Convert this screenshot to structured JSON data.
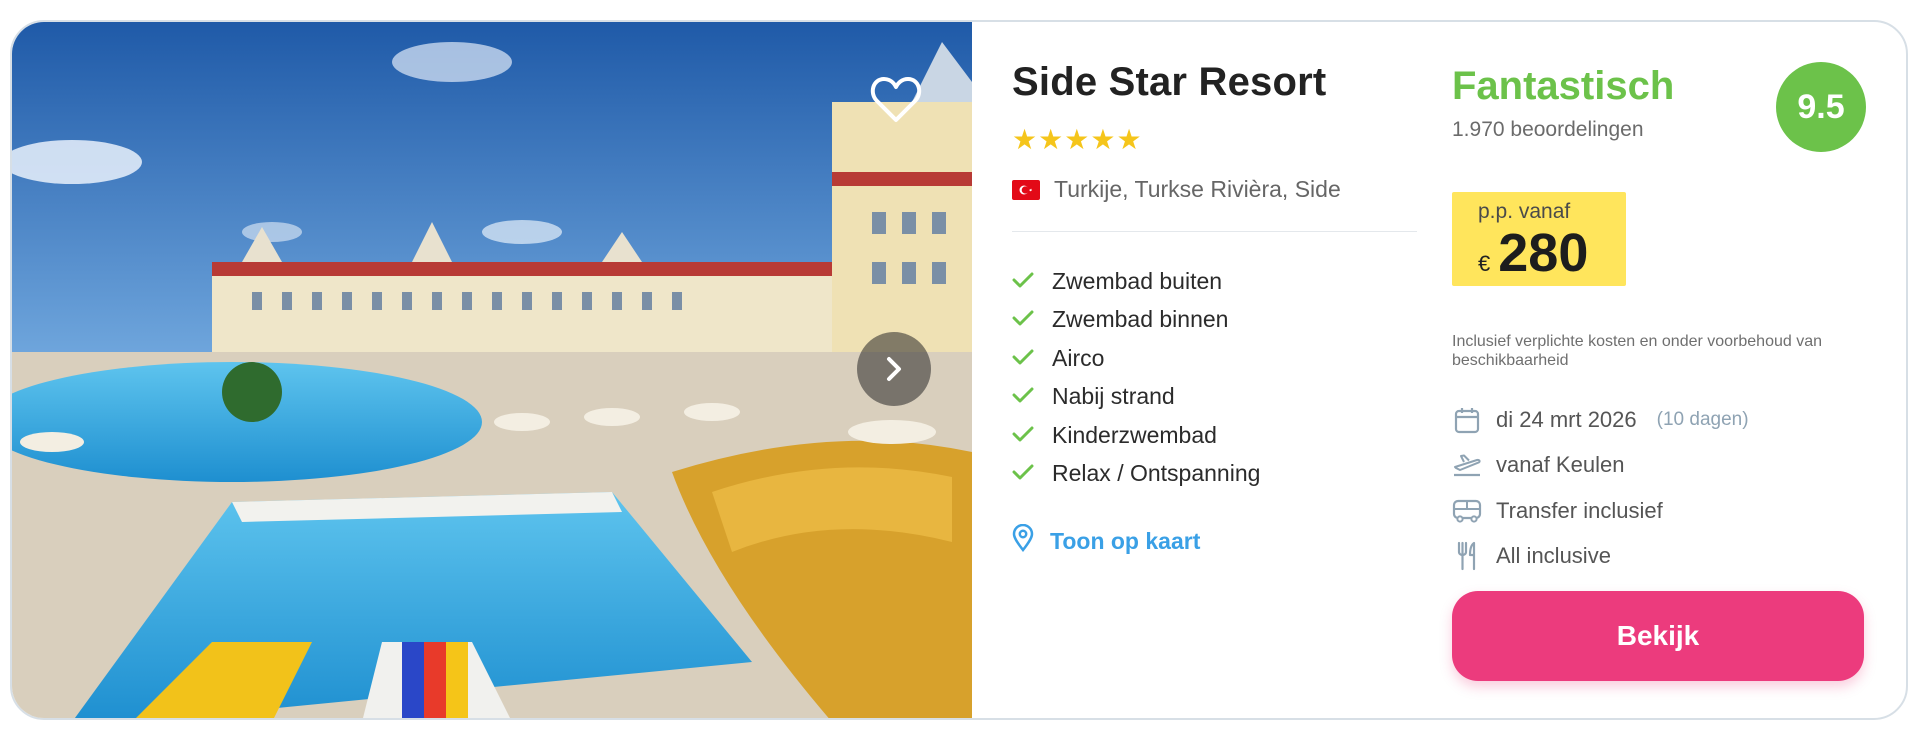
{
  "hotel": {
    "name": "Side Star Resort",
    "stars": 5,
    "star_glyph": "★",
    "location": "Turkije, Turkse Rivièra, Side",
    "flag_icon": "turkey-flag-icon",
    "features": [
      "Zwembad buiten",
      "Zwembad binnen",
      "Airco",
      "Nabij strand",
      "Kinderzwembad",
      "Relax / Ontspanning"
    ],
    "map_link": "Toon op kaart"
  },
  "rating": {
    "label": "Fantastisch",
    "reviews": "1.970 beoordelingen",
    "score": "9.5"
  },
  "price": {
    "from_label": "p.p. vanaf",
    "currency": "€",
    "amount": "280",
    "disclaimer": "Inclusief verplichte kosten en onder voorbehoud van beschikbaarheid"
  },
  "trip": {
    "date": "di 24 mrt 2026",
    "duration": "(10 dagen)",
    "departure": "vanaf Keulen",
    "transfer": "Transfer inclusief",
    "board": "All inclusive"
  },
  "cta": {
    "label": "Bekijk"
  },
  "colors": {
    "rating_green": "#6cc24a",
    "price_yellow": "#ffe55c",
    "cta_pink": "#ec3b7d",
    "link_blue": "#3aa0e6",
    "star_gold": "#f5c51b"
  }
}
